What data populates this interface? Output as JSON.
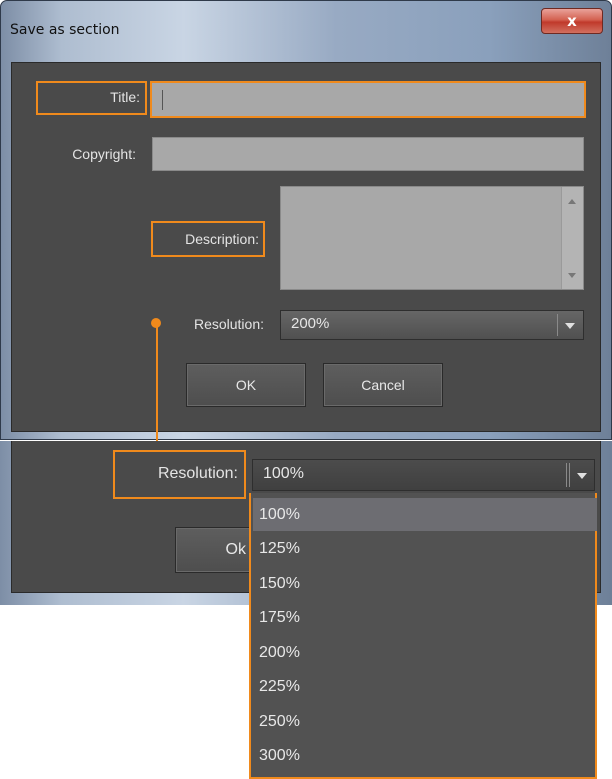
{
  "dialog": {
    "title": "Save as section",
    "close_glyph": "x",
    "fields": {
      "title_label": "Title:",
      "title_value": "",
      "copyright_label": "Copyright:",
      "copyright_value": "",
      "description_label": "Description:",
      "description_value": "",
      "resolution_label": "Resolution:",
      "resolution_value": "200%"
    },
    "buttons": {
      "ok": "OK",
      "cancel": "Cancel"
    }
  },
  "expanded": {
    "resolution_label": "Resolution:",
    "resolution_value": "100%",
    "ok_partial": "Ok",
    "options": [
      "100%",
      "125%",
      "150%",
      "175%",
      "200%",
      "225%",
      "250%",
      "300%"
    ],
    "selected_index": 0
  },
  "colors": {
    "accent": "#f08a1c",
    "panel": "#4a4a4a",
    "field": "#a8a8a8",
    "selected_option": "#6d6d72"
  }
}
